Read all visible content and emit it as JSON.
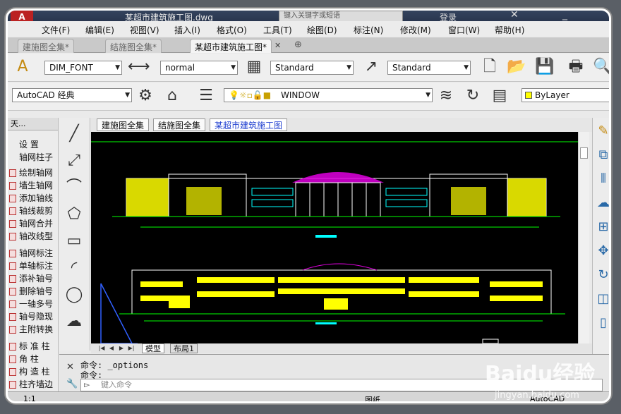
{
  "title_bar": {
    "app_button_label": "A",
    "document_title": "某超市建筑施工图.dwg",
    "search_placeholder": "键入关键字或短语",
    "login_label": "登录"
  },
  "menu": {
    "items": [
      "文件(F)",
      "编辑(E)",
      "视图(V)",
      "插入(I)",
      "格式(O)",
      "工具(T)",
      "绘图(D)",
      "标注(N)",
      "修改(M)",
      "窗口(W)",
      "帮助(H)"
    ]
  },
  "doc_tabs": [
    "建施图全集*",
    "结施图全集*",
    "某超市建筑施工图*"
  ],
  "toolbar1": {
    "text_style": "DIM_FONT",
    "dim_style": "normal",
    "table_style": "Standard",
    "multileader_style": "Standard"
  },
  "toolbar2": {
    "workspace": "AutoCAD 经典",
    "layer": "WINDOW",
    "color": "ByLayer"
  },
  "left_palette": {
    "header": "天...",
    "items": [
      "设  置",
      "轴网柱子",
      "绘制轴网",
      "墙生轴网",
      "添加轴线",
      "轴线裁剪",
      "轴网合并",
      "轴改线型",
      "轴网标注",
      "单轴标注",
      "添补轴号",
      "删除轴号",
      "一轴多号",
      "轴号隐现",
      "主附转换",
      "标 准 柱",
      "角  柱",
      "构 造 柱",
      "柱齐墙边"
    ]
  },
  "layout_tabs": [
    "建施图全集",
    "结施图全集",
    "某超市建筑施工图"
  ],
  "model_tabs": [
    "模型",
    "布局1"
  ],
  "command": {
    "history": [
      "命令: _options",
      "命令:"
    ],
    "input_placeholder": "键入命令"
  },
  "status": {
    "coords": "1:1",
    "layout_label": "图纸",
    "app_label": "AutoCAD"
  },
  "watermark": {
    "logo": "Baidu经验",
    "url": "jingyan.baidu.com"
  },
  "colors": {
    "canvas_bg": "#000000",
    "building_yellow": "#ffff00",
    "outline_white": "#ffffff",
    "dome_magenta": "#e000e0",
    "dim_green": "#00ff00",
    "accent_blue": "#2040d0"
  }
}
